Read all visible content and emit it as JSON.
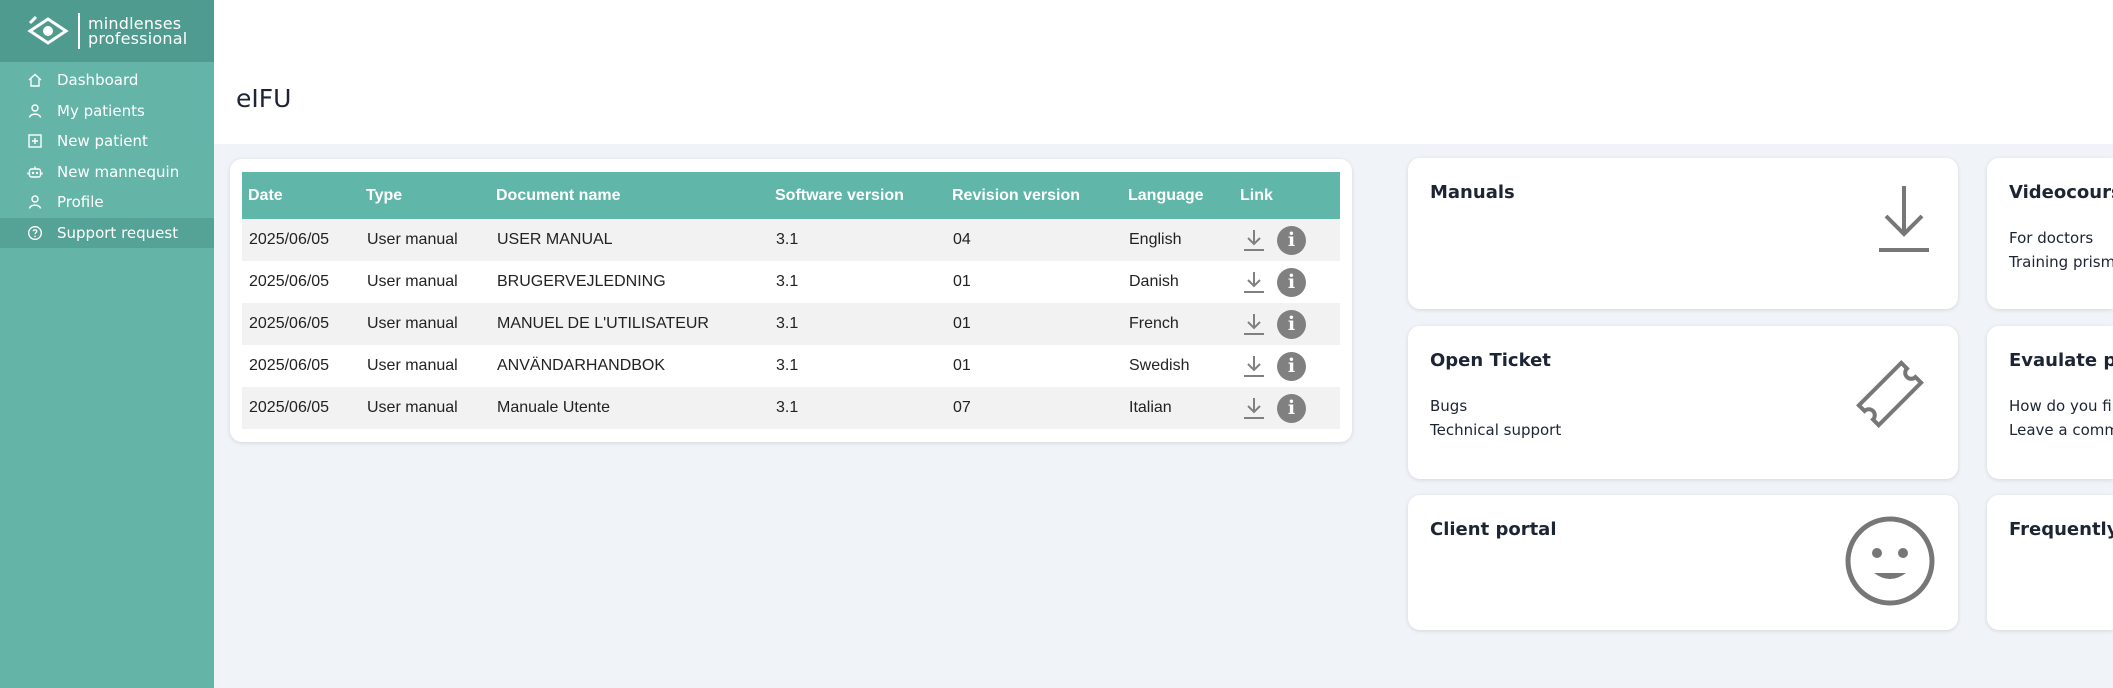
{
  "brand": {
    "line1": "mindlenses",
    "line2": "professional"
  },
  "sidebar": {
    "items": [
      {
        "label": "Dashboard",
        "icon": "home-icon"
      },
      {
        "label": "My patients",
        "icon": "person-icon"
      },
      {
        "label": "New patient",
        "icon": "plus-square-icon"
      },
      {
        "label": "New mannequin",
        "icon": "robot-icon"
      },
      {
        "label": "Profile",
        "icon": "person-icon"
      },
      {
        "label": "Support request",
        "icon": "question-circle-icon"
      }
    ],
    "active_index": 5
  },
  "page": {
    "title": "eIFU"
  },
  "table": {
    "headers": [
      "Date",
      "Type",
      "Document name",
      "Software version",
      "Revision version",
      "Language",
      "Link"
    ],
    "rows": [
      {
        "date": "2025/06/05",
        "type": "User manual",
        "name": "USER MANUAL",
        "software": "3.1",
        "revision": "04",
        "language": "English"
      },
      {
        "date": "2025/06/05",
        "type": "User manual",
        "name": "BRUGERVEJLEDNING",
        "software": "3.1",
        "revision": "01",
        "language": "Danish"
      },
      {
        "date": "2025/06/05",
        "type": "User manual",
        "name": "MANUEL DE L'UTILISATEUR",
        "software": "3.1",
        "revision": "01",
        "language": "French"
      },
      {
        "date": "2025/06/05",
        "type": "User manual",
        "name": "ANVÄNDARHANDBOK",
        "software": "3.1",
        "revision": "01",
        "language": "Swedish"
      },
      {
        "date": "2025/06/05",
        "type": "User manual",
        "name": "Manuale Utente",
        "software": "3.1",
        "revision": "07",
        "language": "Italian"
      }
    ]
  },
  "tiles": {
    "manuals": {
      "title": "Manuals",
      "icon": "download-icon"
    },
    "open_ticket": {
      "title": "Open Ticket",
      "lines": [
        "Bugs",
        "Technical support"
      ],
      "icon": "ticket-icon"
    },
    "client_portal": {
      "title": "Client portal",
      "icon": "smiley-icon"
    },
    "videocourse": {
      "title": "Videocourse",
      "lines": [
        "For doctors",
        "Training prisma"
      ]
    },
    "evaluate": {
      "title": "Evaulate pla",
      "lines": [
        "How do you find",
        "Leave a comme"
      ]
    },
    "faq": {
      "title": "Frequently A"
    }
  },
  "colors": {
    "sidebar": "#64b5a8",
    "sidebar_logo": "#4f9b8f",
    "table_header": "#5fb6a9",
    "background": "#f0f3f7"
  }
}
